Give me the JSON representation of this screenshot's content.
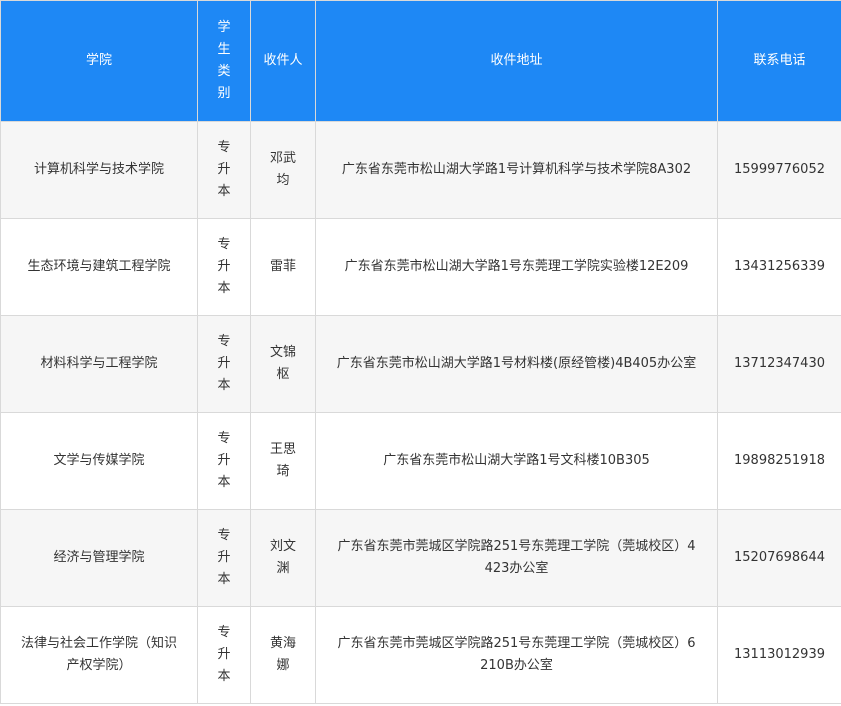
{
  "table": {
    "headers": {
      "college": "学院",
      "student_type": "学生类别",
      "recipient": "收件人",
      "address": "收件地址",
      "phone": "联系电话"
    },
    "rows": [
      {
        "college": "计算机科学与技术学院",
        "student_type": "专升本",
        "recipient": "邓武均",
        "address": "广东省东莞市松山湖大学路1号计算机科学与技术学院8A302",
        "phone": "15999776052"
      },
      {
        "college": "生态环境与建筑工程学院",
        "student_type": "专升本",
        "recipient": "雷菲",
        "address": "广东省东莞市松山湖大学路1号东莞理工学院实验楼12E209",
        "phone": "13431256339"
      },
      {
        "college": "材料科学与工程学院",
        "student_type": "专升本",
        "recipient": "文锦枢",
        "address": "广东省东莞市松山湖大学路1号材料楼(原经管楼)4B405办公室",
        "phone": "13712347430"
      },
      {
        "college": "文学与传媒学院",
        "student_type": "专升本",
        "recipient": "王思琦",
        "address": "广东省东莞市松山湖大学路1号文科楼10B305",
        "phone": "19898251918"
      },
      {
        "college": "经济与管理学院",
        "student_type": "专升本",
        "recipient": "刘文渊",
        "address": "广东省东莞市莞城区学院路251号东莞理工学院（莞城校区）4423办公室",
        "phone": "15207698644"
      },
      {
        "college": "法律与社会工作学院（知识产权学院）",
        "student_type": "专升本",
        "recipient": "黄海娜",
        "address": "广东省东莞市莞城区学院路251号东莞理工学院（莞城校区）6210B办公室",
        "phone": "13113012939"
      }
    ]
  },
  "colors": {
    "header_bg": "#1e88f5",
    "header_text": "#ffffff",
    "stripe_bg": "#f6f6f6",
    "border": "#d9d9d9",
    "body_text": "#333333"
  }
}
